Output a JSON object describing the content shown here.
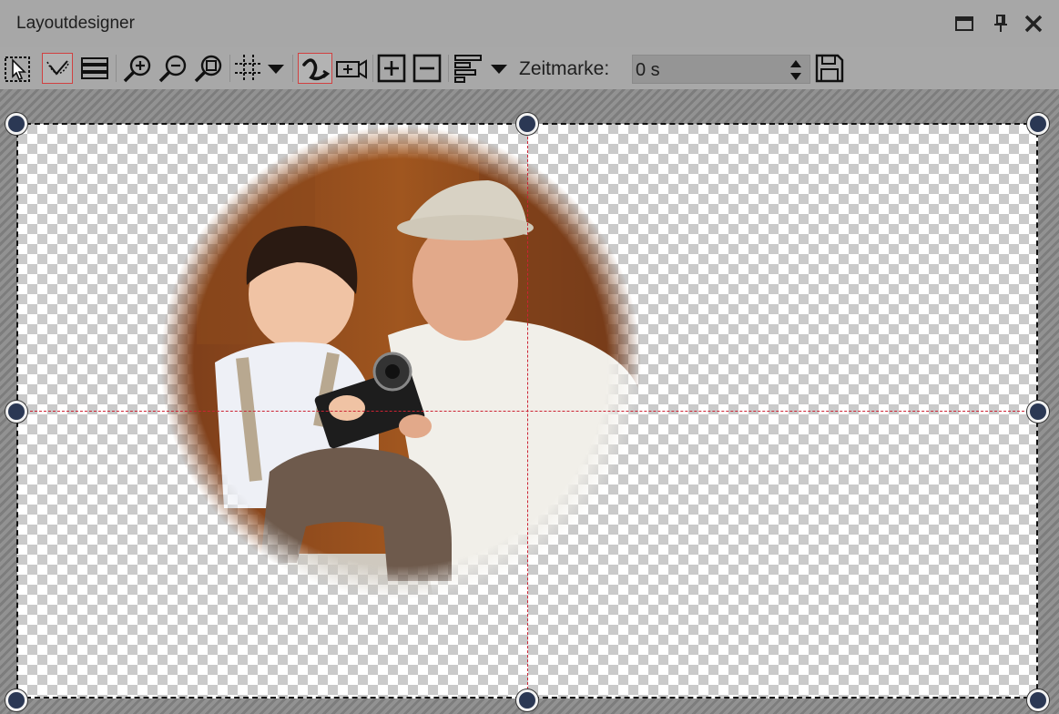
{
  "window": {
    "title": "Layoutdesigner",
    "controls": [
      "maximize-icon",
      "pin-icon",
      "close-icon"
    ]
  },
  "toolbar": {
    "buttons": [
      "select-rectangle-icon",
      "path-edit-icon",
      "layers-icon",
      "zoom-in-icon",
      "zoom-out-icon",
      "zoom-fit-icon",
      "grid-icon",
      "curve-path-icon",
      "camera-add-icon",
      "add-keyframe-icon",
      "remove-keyframe-icon",
      "align-icon",
      "save-icon"
    ],
    "zeitmarke_label": "Zeitmarke:",
    "zeitmarke_value": "0 s"
  },
  "colors": {
    "guide_line": "#cc2233",
    "handle_fill": "#2b3854",
    "active_border": "#d14040"
  }
}
